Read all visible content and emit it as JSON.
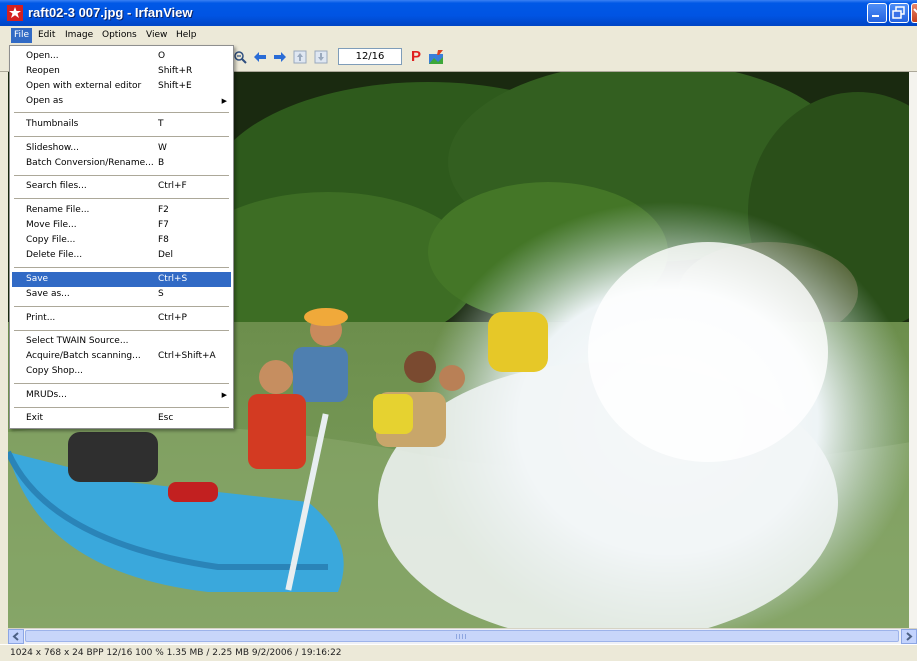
{
  "window": {
    "title": "raft02-3 007.jpg - IrfanView"
  },
  "menubar": {
    "items": [
      "File",
      "Edit",
      "Image",
      "Options",
      "View",
      "Help"
    ]
  },
  "toolbar": {
    "page_indicator": "12/16",
    "p_label": "P"
  },
  "file_menu": {
    "items": [
      {
        "label": "Open...",
        "shortcut": "O"
      },
      {
        "label": "Reopen",
        "shortcut": "Shift+R"
      },
      {
        "label": "Open with external editor",
        "shortcut": "Shift+E"
      },
      {
        "label": "Open as",
        "shortcut": ""
      },
      {
        "label": "Thumbnails",
        "shortcut": "T"
      },
      {
        "label": "Slideshow...",
        "shortcut": "W"
      },
      {
        "label": "Batch Conversion/Rename...",
        "shortcut": "B"
      },
      {
        "label": "Search files...",
        "shortcut": "Ctrl+F"
      },
      {
        "label": "Rename File...",
        "shortcut": "F2"
      },
      {
        "label": "Move File...",
        "shortcut": "F7"
      },
      {
        "label": "Copy File...",
        "shortcut": "F8"
      },
      {
        "label": "Delete File...",
        "shortcut": "Del"
      },
      {
        "label": "Save",
        "shortcut": "Ctrl+S"
      },
      {
        "label": "Save as...",
        "shortcut": "S"
      },
      {
        "label": "Print...",
        "shortcut": "Ctrl+P"
      },
      {
        "label": "Select TWAIN Source...",
        "shortcut": ""
      },
      {
        "label": "Acquire/Batch scanning...",
        "shortcut": "Ctrl+Shift+A"
      },
      {
        "label": "Copy Shop...",
        "shortcut": ""
      },
      {
        "label": "MRUDs...",
        "shortcut": ""
      },
      {
        "label": "Exit",
        "shortcut": "Esc"
      }
    ]
  },
  "status": {
    "text": "1024 x 768 x 24 BPP   12/16   100 %   1.35 MB / 2.25 MB   9/2/2006 / 19:16:22"
  },
  "colors": {
    "titlebar": "#0054e3",
    "highlight": "#316ac5",
    "chrome": "#ece9d8"
  },
  "icons": [
    "app-logo-icon",
    "zoom-out-icon",
    "previous-arrow-icon",
    "next-arrow-icon",
    "first-file-icon",
    "last-file-icon",
    "paint-icon",
    "minimize-icon",
    "maximize-icon",
    "close-icon"
  ]
}
